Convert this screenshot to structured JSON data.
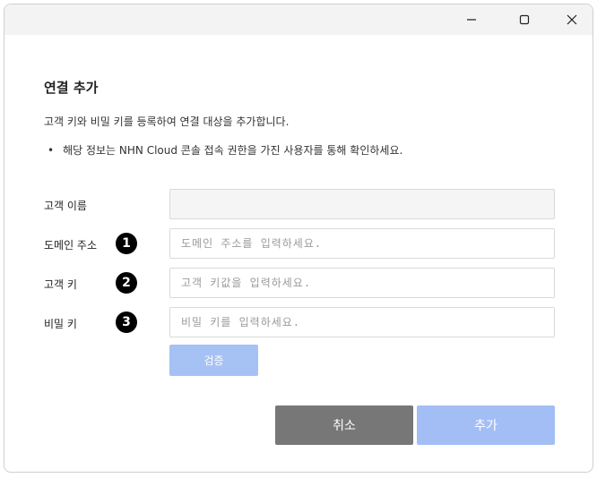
{
  "window": {
    "controls": {
      "minimize": "minimize-icon",
      "maximize": "maximize-icon",
      "close": "close-icon"
    }
  },
  "dialog": {
    "title": "연결 추가",
    "description": "고객 키와 비밀 키를 등록하여 연결 대상을 추가합니다.",
    "bullet_marker": "•",
    "bullet": "해당 정보는 NHN Cloud 콘솔 접속 권한을 가진 사용자를 통해 확인하세요."
  },
  "form": {
    "customer_name": {
      "label": "고객 이름",
      "value": "",
      "placeholder": ""
    },
    "domain": {
      "label": "도메인 주소",
      "badge": "1",
      "value": "",
      "placeholder": "도메인 주소를 입력하세요."
    },
    "customer_key": {
      "label": "고객 키",
      "badge": "2",
      "value": "",
      "placeholder": "고객 키값을 입력하세요."
    },
    "secret_key": {
      "label": "비밀 키",
      "badge": "3",
      "value": "",
      "placeholder": "비밀 키를 입력하세요."
    },
    "verify_label": "검증"
  },
  "footer": {
    "cancel_label": "취소",
    "add_label": "추가"
  },
  "colors": {
    "primary_disabled": "#a3bef5",
    "cancel": "#777777",
    "titlebar": "#f3f3f3"
  }
}
